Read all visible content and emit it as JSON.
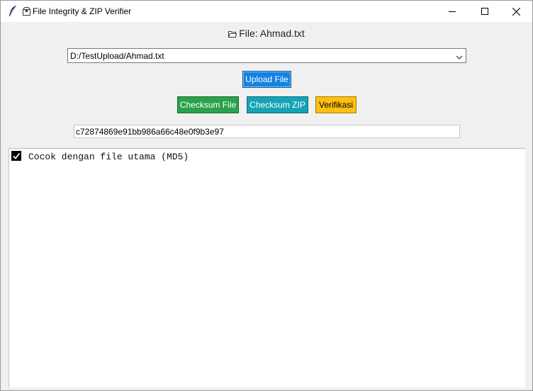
{
  "window": {
    "title": "File Integrity & ZIP Verifier",
    "title_icon": "package-emoji-icon",
    "app_icon": "tk-feather-icon",
    "controls": [
      "minimize",
      "maximize",
      "close"
    ]
  },
  "file_label": {
    "icon": "open-folder-icon",
    "text": "File: Ahmad.txt"
  },
  "file_path": {
    "value": "D:/TestUpload/Ahmad.txt",
    "icon": "chevron-down-icon"
  },
  "buttons": {
    "upload": "Upload File",
    "checksum_file": "Checksum File",
    "checksum_zip": "Checksum ZIP",
    "verify": "Verifikasi"
  },
  "hash_entry": {
    "value": "c72874869e91bb986a66c48e0f9b3e97"
  },
  "output": {
    "lines": [
      {
        "icon": "check-mark-icon",
        "text": "Cocok dengan file utama (MD5)"
      }
    ]
  },
  "colors": {
    "upload": "#1283e0",
    "checksum_file": "#2aa24a",
    "checksum_zip": "#16a3b6",
    "verify": "#fcc012",
    "window_bg": "#f0f0f0"
  }
}
